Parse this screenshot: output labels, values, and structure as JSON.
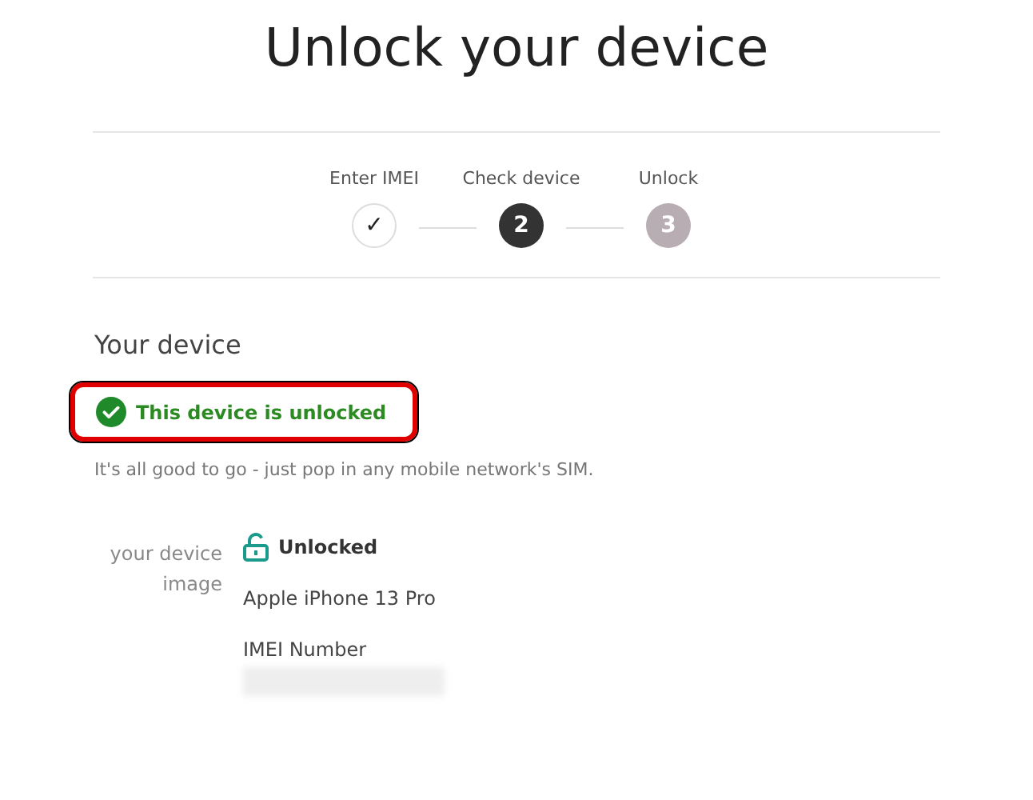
{
  "title": "Unlock your device",
  "steps": [
    {
      "label": "Enter IMEI",
      "kind": "done",
      "marker": "✓"
    },
    {
      "label": "Check device",
      "kind": "current",
      "marker": "2"
    },
    {
      "label": "Unlock",
      "kind": "pending",
      "marker": "3"
    }
  ],
  "section_title": "Your device",
  "status_badge": {
    "text": "This device is unlocked",
    "highlighted": true
  },
  "description": "It's all good to go - just pop in any mobile network's SIM.",
  "device": {
    "image_alt": "your device image",
    "lock_status": "Unlocked",
    "model": "Apple iPhone 13 Pro",
    "imei_label": "IMEI Number",
    "imei_blurred": true
  }
}
